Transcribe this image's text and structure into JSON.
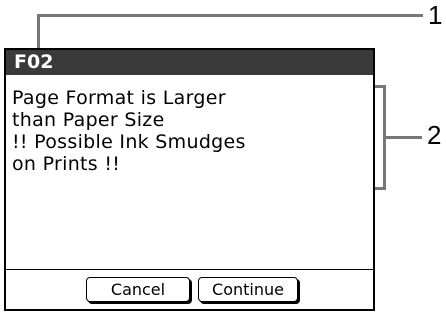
{
  "dialog": {
    "code": "F02",
    "message": "Page Format is Larger\nthan Paper Size\n!! Possible Ink Smudges\non Prints !!",
    "buttons": {
      "cancel_label": "Cancel",
      "continue_label": "Continue"
    }
  },
  "callouts": [
    {
      "number": "1"
    },
    {
      "number": "2"
    }
  ]
}
